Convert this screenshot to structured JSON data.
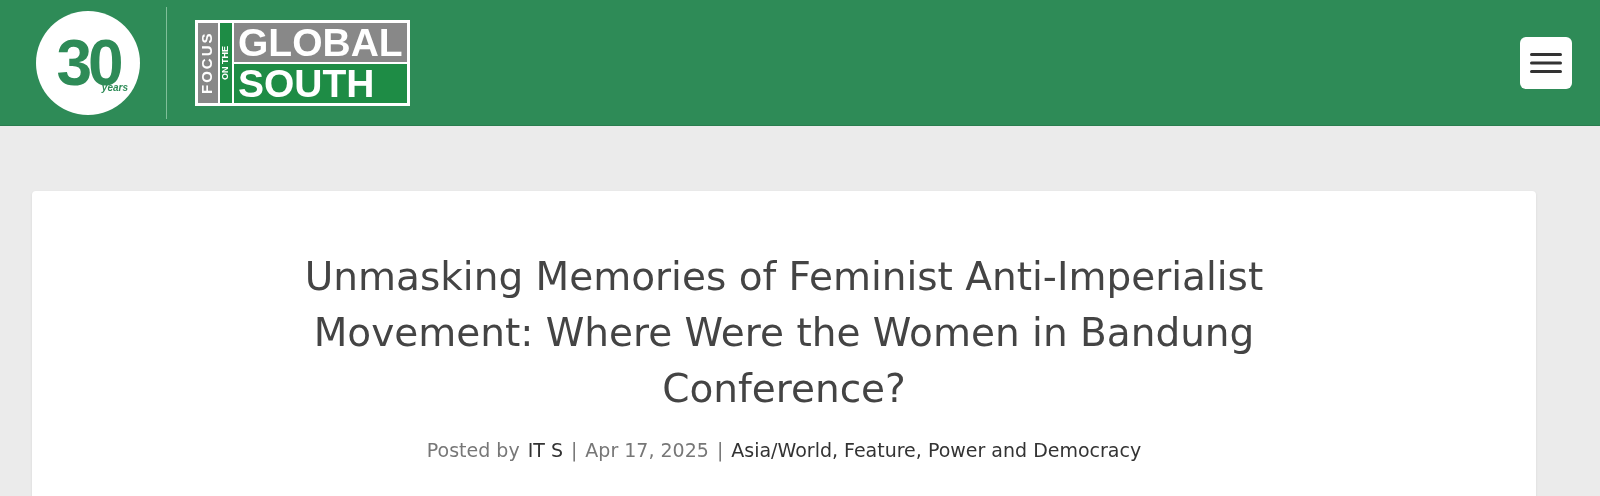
{
  "header": {
    "anniversary_logo": {
      "number": "30",
      "caption": "years"
    },
    "logo": {
      "vertical_word": "FOCUS",
      "small_words": "ON THE",
      "top_word": "GLOBAL",
      "bottom_word": "SOUTH"
    }
  },
  "article": {
    "title": "Unmasking Memories of Feminist Anti-Imperialist Movement: Where Were the Women in Bandung Conference?",
    "meta": {
      "prefix": "Posted by",
      "author": "IT S",
      "separator_1": "|",
      "date": "Apr 17, 2025",
      "separator_2": "|",
      "categories": [
        "Asia/World",
        "Feature",
        "Power and Democracy"
      ],
      "category_separator": ","
    }
  }
}
